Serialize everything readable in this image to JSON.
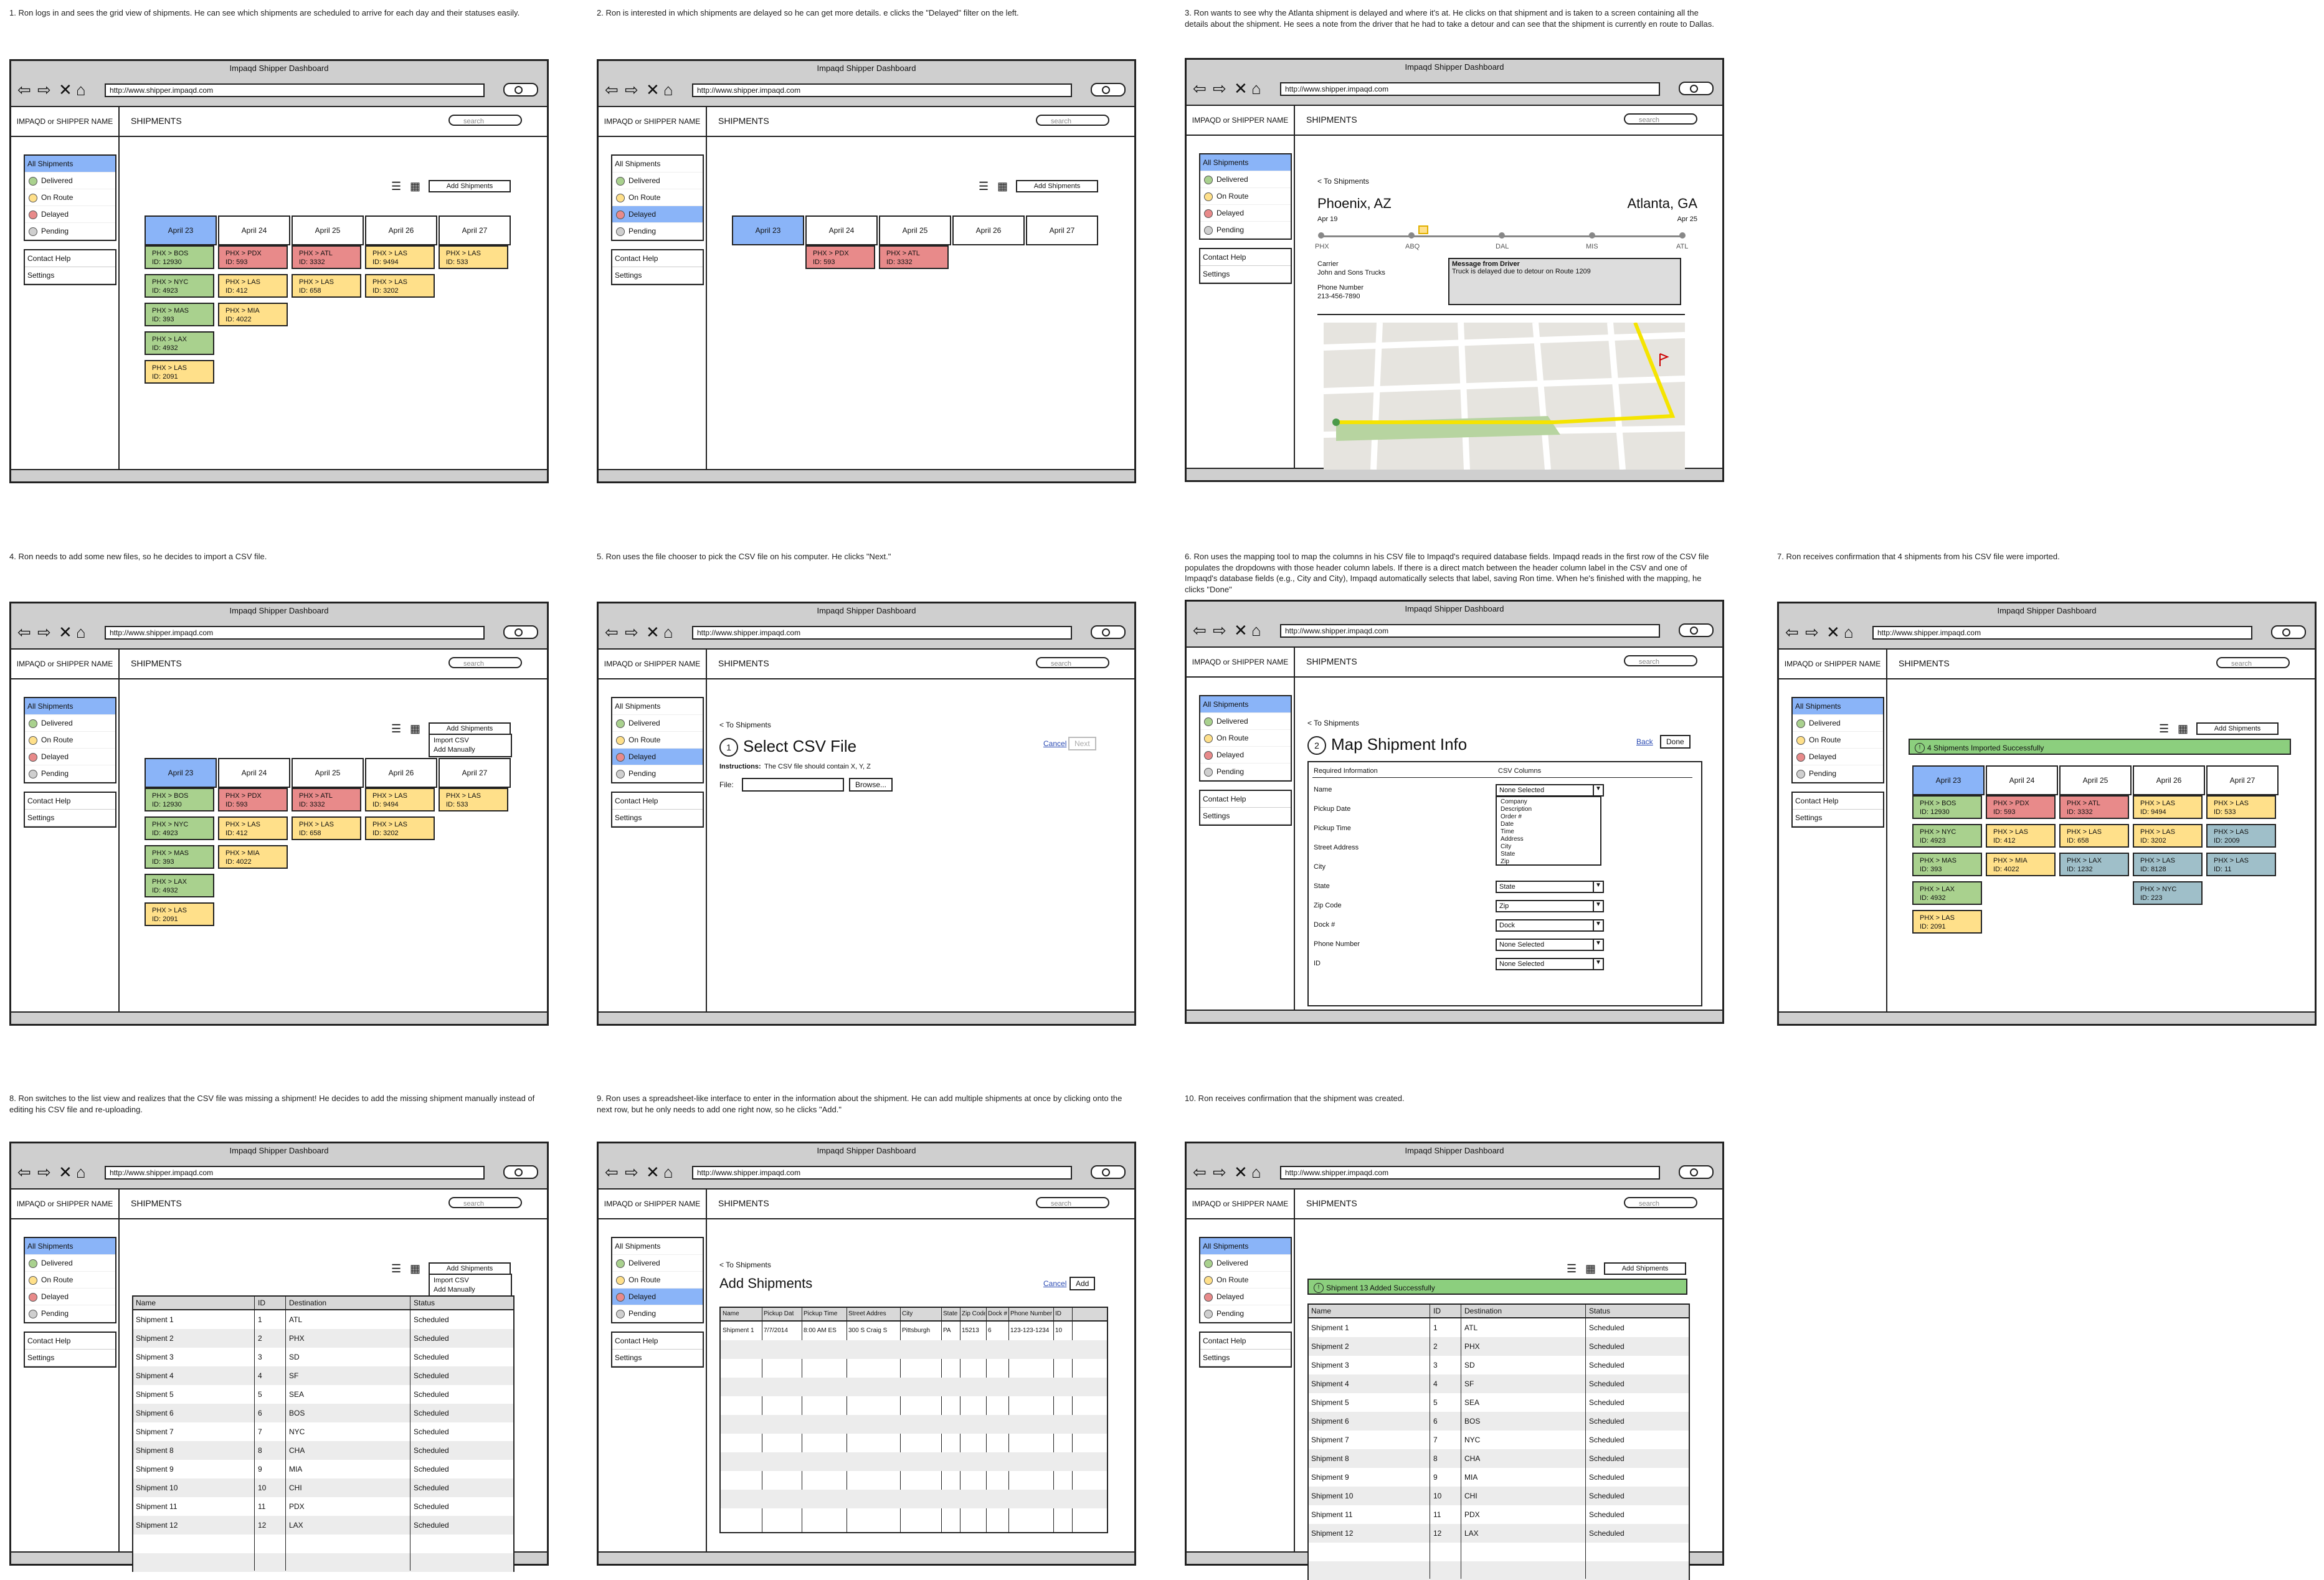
{
  "app": {
    "window_title": "Impaqd Shipper Dashboard",
    "url": "http://www.shipper.impaqd.com",
    "logo_text": "IMPAQD or SHIPPER NAME",
    "page_title": "SHIPMENTS",
    "search_placeholder": "search",
    "add_shipments": "Add Shipments",
    "filters": [
      "All Shipments",
      "Delivered",
      "On Route",
      "Delayed",
      "Pending"
    ],
    "filter_colors": [
      "",
      "#a9d18e",
      "#ffe08a",
      "#e88a8a",
      "#cfcfcf"
    ],
    "sidelinks": [
      "Contact Help",
      "Settings"
    ],
    "days": [
      "April 23",
      "April 24",
      "April 25",
      "April 26",
      "April 27"
    ],
    "dropdown": [
      "Add Shipments",
      "Import CSV",
      "Add Manually"
    ],
    "back": "< To Shipments",
    "cancel": "Cancel",
    "next": "Next",
    "back_btn": "Back",
    "done": "Done",
    "add": "Add"
  },
  "captions": [
    "1. Ron logs in and sees the grid view of shipments. He can see which shipments are scheduled to arrive for each day and their statuses easily.",
    "2. Ron is interested in which shipments are delayed so he can get more details. e clicks the \"Delayed\" filter on the left.",
    "3. Ron wants to see why the Atlanta shipment is delayed and where it's at. He clicks on that shipment and is taken to a screen containing all the details about the shipment. He sees a note from the driver that he had to take a detour and can see that the shipment is currently en route to Dallas.",
    "4. Ron needs to add some new files, so he decides to import a CSV file.",
    "5. Ron uses the file chooser to pick the CSV file on his computer. He clicks \"Next.\"",
    "6. Ron uses the mapping tool to map the columns in his CSV file to Impaqd's required database fields. Impaqd reads in the first row of the CSV file populates the dropdowns with those header column labels. If there is a direct match between the header column label in the CSV and one of Impaqd's database fields (e.g., City and City), Impaqd automatically selects that label, saving Ron time. When he's finished with the mapping, he clicks \"Done\"",
    "7. Ron receives confirmation that 4 shipments from his CSV file were imported.",
    "8. Ron switches to the list view and realizes that the CSV file was missing a shipment! He decides to add the missing shipment manually instead of editing his CSV file and re-uploading.",
    "9. Ron uses a spreadsheet-like interface to enter in the information about the shipment. He can add multiple shipments at once by clicking onto the next row, but he only needs to add one right now, so he clicks \"Add.\"",
    "10. Ron receives confirmation that the shipment was created."
  ],
  "grid_cards": {
    "col0": [
      [
        "PHX > BOS",
        "ID: 12930",
        "g"
      ],
      [
        "PHX > NYC",
        "ID: 4923",
        "g"
      ],
      [
        "PHX > MAS",
        "ID: 393",
        "g"
      ],
      [
        "PHX > LAX",
        "ID: 4932",
        "g"
      ],
      [
        "PHX > LAS",
        "ID: 2091",
        "y"
      ]
    ],
    "col1": [
      [
        "PHX > PDX",
        "ID: 593",
        "r"
      ],
      [
        "PHX > LAS",
        "ID: 412",
        "y"
      ],
      [
        "PHX > MIA",
        "ID: 4022",
        "y"
      ]
    ],
    "col2": [
      [
        "PHX > ATL",
        "ID: 3332",
        "r"
      ],
      [
        "PHX > LAS",
        "ID: 658",
        "y"
      ]
    ],
    "col3": [
      [
        "PHX > LAS",
        "ID: 9494",
        "y"
      ],
      [
        "PHX > LAS",
        "ID: 3202",
        "y"
      ]
    ],
    "col4": [
      [
        "PHX > LAS",
        "ID: 533",
        "y"
      ]
    ]
  },
  "grid_cards_imported": {
    "col0": [
      [
        "PHX > BOS",
        "ID: 12930",
        "g"
      ],
      [
        "PHX > NYC",
        "ID: 4923",
        "g"
      ],
      [
        "PHX > MAS",
        "ID: 393",
        "g"
      ],
      [
        "PHX > LAX",
        "ID: 4932",
        "g"
      ],
      [
        "PHX > LAS",
        "ID: 2091",
        "y"
      ]
    ],
    "col1": [
      [
        "PHX > PDX",
        "ID: 593",
        "r"
      ],
      [
        "PHX > LAS",
        "ID: 412",
        "y"
      ],
      [
        "PHX > MIA",
        "ID: 4022",
        "y"
      ]
    ],
    "col2": [
      [
        "PHX > ATL",
        "ID: 3332",
        "r"
      ],
      [
        "PHX > LAS",
        "ID: 658",
        "y"
      ],
      [
        "PHX > LAX",
        "ID: 1232",
        "t"
      ]
    ],
    "col3": [
      [
        "PHX > LAS",
        "ID: 9494",
        "y"
      ],
      [
        "PHX > LAS",
        "ID: 3202",
        "y"
      ],
      [
        "PHX > LAS",
        "ID: 8128",
        "t"
      ],
      [
        "PHX > NYC",
        "ID: 223",
        "t"
      ]
    ],
    "col4": [
      [
        "PHX > LAS",
        "ID: 533",
        "y"
      ],
      [
        "PHX > LAS",
        "ID: 2009",
        "t"
      ],
      [
        "PHX > LAS",
        "ID: 11",
        "t"
      ]
    ]
  },
  "delayed_cards": {
    "col1": [
      [
        "PHX > PDX",
        "ID: 593",
        "r"
      ]
    ],
    "col2": [
      [
        "PHX > ATL",
        "ID: 3332",
        "r"
      ]
    ]
  },
  "detail": {
    "origin": "Phoenix, AZ",
    "destination": "Atlanta, GA",
    "origin_date": "Apr 19",
    "dest_date": "Apr 25",
    "stops": [
      "PHX",
      "ABQ",
      "DAL",
      "MIS",
      "ATL"
    ],
    "carrier_label": "Carrier",
    "carrier": "John and Sons Trucks",
    "phone_label": "Phone Number",
    "phone": "213-456-7890",
    "msg_label": "Message from Driver",
    "msg": "Truck is delayed due to detour on Route 1209"
  },
  "csv": {
    "step": "1",
    "title": "Select CSV File",
    "instructions_label": "Instructions:",
    "instructions": "The CSV file should contain X, Y, Z",
    "file_label": "File:",
    "browse": "Browse..."
  },
  "mapping": {
    "step": "2",
    "title": "Map Shipment Info",
    "col_required": "Required Information",
    "col_csv": "CSV Columns",
    "fields": [
      "Name",
      "Pickup Date",
      "Pickup Time",
      "Street Address",
      "City",
      "State",
      "Zip Code",
      "Dock #",
      "Phone Number",
      "ID"
    ],
    "selected": [
      "None Selected",
      "",
      "",
      "",
      "",
      "State",
      "Zip",
      "Dock",
      "None Selected",
      "None Selected"
    ],
    "options": [
      "Company",
      "Description",
      "Order #",
      "Date",
      "Time",
      "Address",
      "City",
      "State",
      "Zip"
    ]
  },
  "imported_banner": "4 Shipments Imported Successfully",
  "added_banner": "Shipment 13 Added Successfully",
  "list": {
    "headers": [
      "Name",
      "ID",
      "Destination",
      "Status"
    ],
    "rows": [
      [
        "Shipment 1",
        "1",
        "ATL",
        "Scheduled"
      ],
      [
        "Shipment 2",
        "2",
        "PHX",
        "Scheduled"
      ],
      [
        "Shipment 3",
        "3",
        "SD",
        "Scheduled"
      ],
      [
        "Shipment 4",
        "4",
        "SF",
        "Scheduled"
      ],
      [
        "Shipment 5",
        "5",
        "SEA",
        "Scheduled"
      ],
      [
        "Shipment 6",
        "6",
        "BOS",
        "Scheduled"
      ],
      [
        "Shipment 7",
        "7",
        "NYC",
        "Scheduled"
      ],
      [
        "Shipment 8",
        "8",
        "CHA",
        "Scheduled"
      ],
      [
        "Shipment 9",
        "9",
        "MIA",
        "Scheduled"
      ],
      [
        "Shipment 10",
        "10",
        "CHI",
        "Scheduled"
      ],
      [
        "Shipment 11",
        "11",
        "PDX",
        "Scheduled"
      ],
      [
        "Shipment 12",
        "12",
        "LAX",
        "Scheduled"
      ]
    ]
  },
  "add_form": {
    "title": "Add Shipments",
    "headers": [
      "Name",
      "Pickup Dat",
      "Pickup Time",
      "Street Addres",
      "City",
      "State",
      "Zip Code",
      "Dock #",
      "Phone Number",
      "ID"
    ],
    "row": [
      "Shipment 1",
      "7/7/2014",
      "8:00 AM ES",
      "300 S Craig S",
      "Pittsburgh",
      "PA",
      "15213",
      "6",
      "123-123-1234",
      "10"
    ]
  }
}
